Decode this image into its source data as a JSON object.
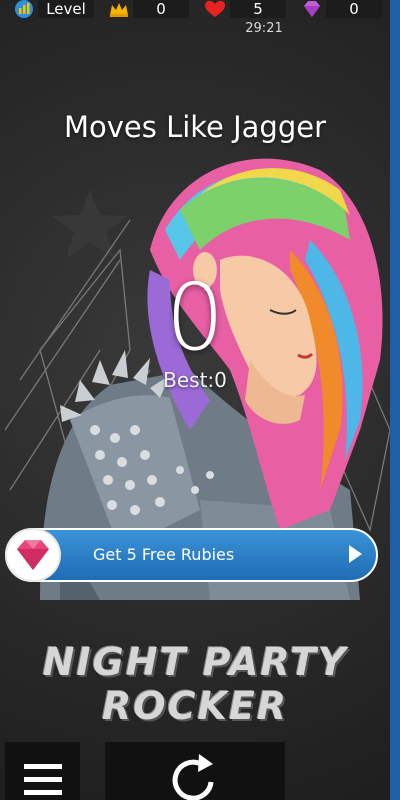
{
  "hud": {
    "level_label": "Level",
    "crowns": "0",
    "lives": "5",
    "gems": "0",
    "timer": "29:21",
    "icons": [
      "level-bars-icon",
      "crown-icon",
      "heart-icon",
      "diamond-icon"
    ]
  },
  "song": {
    "title": "Moves Like Jagger"
  },
  "score": {
    "current": "0",
    "best_label": "Best:0"
  },
  "offer": {
    "label": "Get 5 Free Rubies",
    "icon": "ruby-icon",
    "action_icon": "play-icon"
  },
  "artwork": {
    "brand": "NIGHT PARTY ROCKER"
  },
  "controls": {
    "menu_icon": "hamburger-menu-icon",
    "replay_icon": "replay-icon"
  },
  "colors": {
    "accent_blue": "#2a7fc8",
    "gem_pink": "#e8457a",
    "heart_red": "#e52323",
    "crown_gold": "#f5b400",
    "diamond_purple": "#c45bd8"
  }
}
